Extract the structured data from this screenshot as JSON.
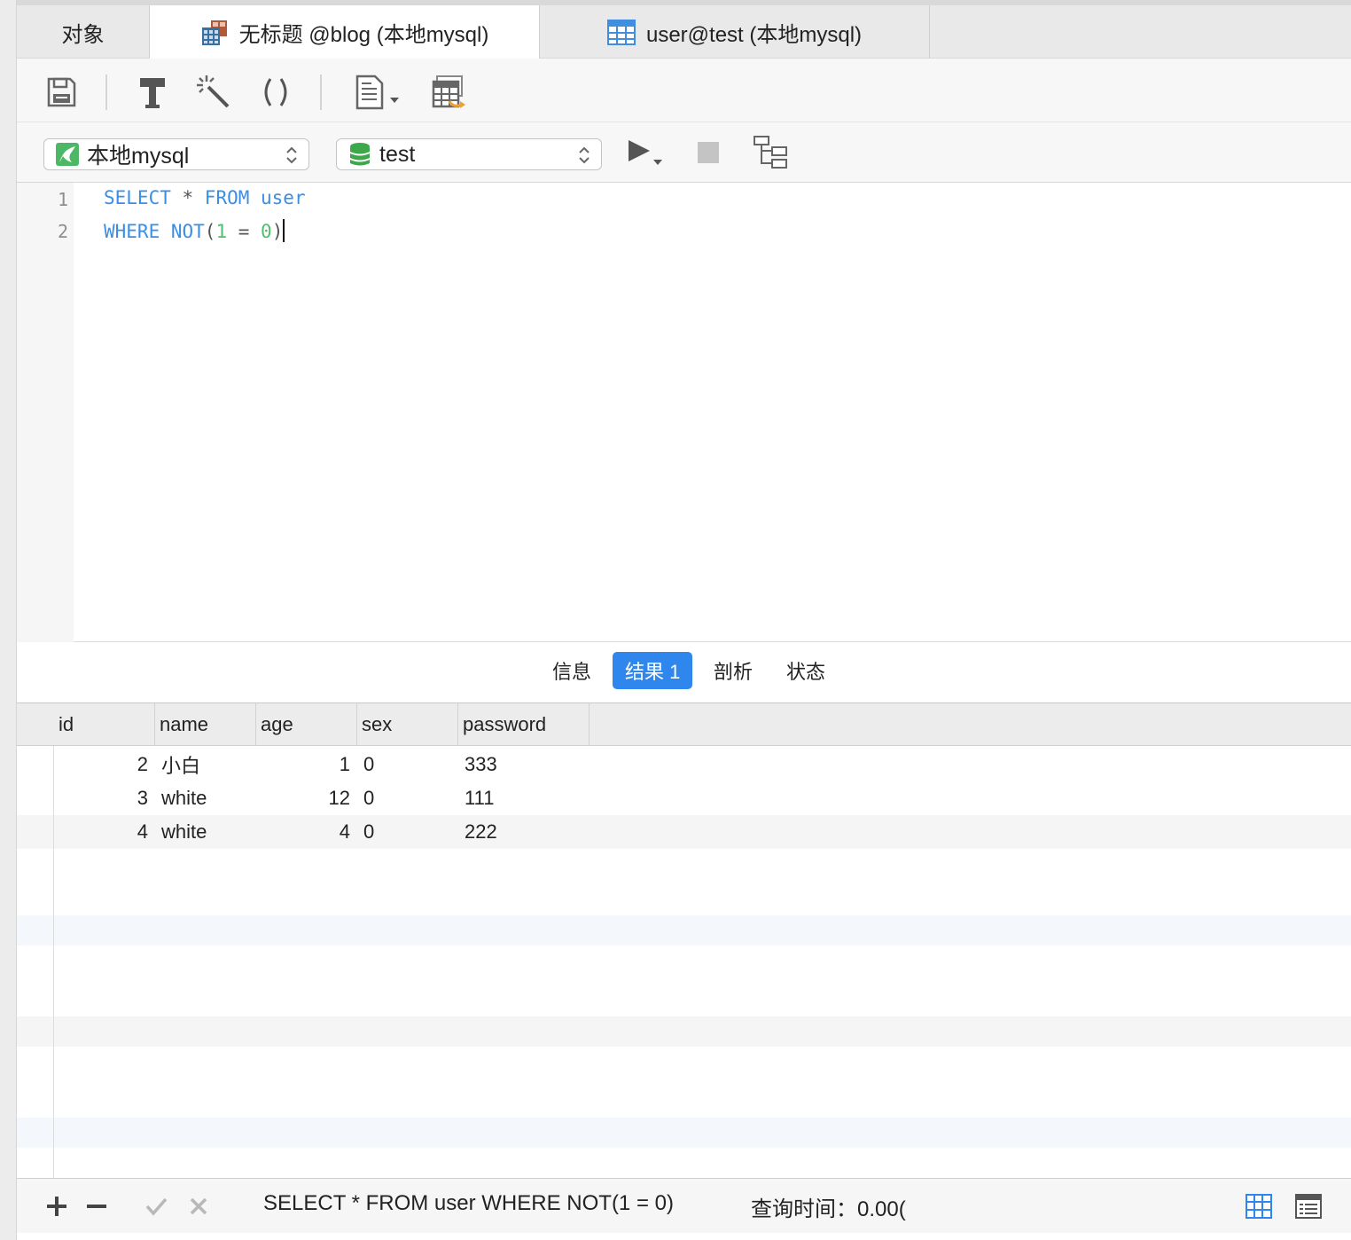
{
  "tabs": [
    {
      "label": "对象",
      "icon": "none"
    },
    {
      "label": "无标题 @blog (本地mysql)",
      "icon": "query-table-icon"
    },
    {
      "label": "user@test (本地mysql)",
      "icon": "table-icon"
    }
  ],
  "toolbar": {
    "icons": [
      "save-icon",
      "format-hammer-icon",
      "magic-wand-icon",
      "parentheses-icon",
      "document-dropdown-icon",
      "export-table-icon"
    ]
  },
  "connection": {
    "label": "本地mysql",
    "icon": "mysql-dolphin-icon"
  },
  "database": {
    "label": "test",
    "icon": "database-icon"
  },
  "run_controls": [
    "run-icon",
    "stop-icon",
    "explain-icon"
  ],
  "editor": {
    "line_numbers": [
      "1",
      "2"
    ],
    "line1": {
      "kw1": "SELECT",
      "op": " * ",
      "kw2": "FROM",
      "kw3": " user"
    },
    "line2": {
      "kw1": "WHERE",
      "kw2": " NOT",
      "p1": "(",
      "n1": "1",
      "op": " = ",
      "n2": "0",
      "p2": ")"
    }
  },
  "result_tabs": [
    "信息",
    "结果 1",
    "剖析",
    "状态"
  ],
  "active_result_tab": 1,
  "grid": {
    "columns": [
      "id",
      "name",
      "age",
      "sex",
      "password"
    ],
    "rows": [
      {
        "id": "2",
        "name": "小白",
        "age": "1",
        "sex": "0",
        "password": "333"
      },
      {
        "id": "3",
        "name": "white",
        "age": "12",
        "sex": "0",
        "password": "111"
      },
      {
        "id": "4",
        "name": "white",
        "age": "4",
        "sex": "0",
        "password": "222"
      }
    ]
  },
  "statusbar": {
    "query_text": "SELECT * FROM user WHERE NOT(1 = 0)",
    "time_label": "查询时间：",
    "time_value": "0.00("
  },
  "colors": {
    "accent": "#2f86ec",
    "keyword": "#3a8ee6",
    "number": "#4fbf6d"
  }
}
